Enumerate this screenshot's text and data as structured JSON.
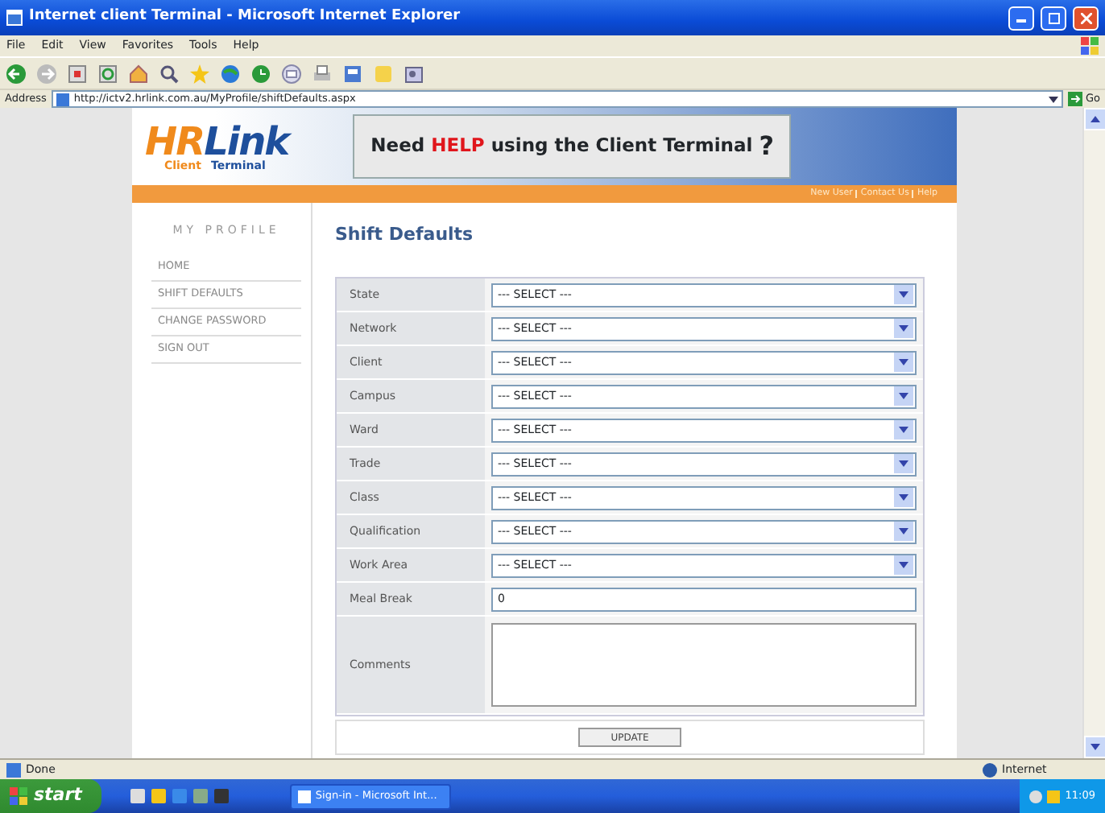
{
  "window": {
    "title": "Internet client Terminal - Microsoft Internet Explorer"
  },
  "menu": [
    "File",
    "Edit",
    "View",
    "Favorites",
    "Tools",
    "Help"
  ],
  "address": {
    "label": "Address",
    "url": "http://ictv2.hrlink.com.au/MyProfile/shiftDefaults.aspx",
    "go": "Go"
  },
  "logo": {
    "primary": "HR",
    "secondary": "Link",
    "sub_left": "Client",
    "sub_right": "Terminal"
  },
  "help_banner": {
    "before": "Need",
    "highlight": "HELP",
    "after": "using the Client Terminal",
    "mark": "?"
  },
  "top_links": [
    "New User",
    "Contact Us",
    "Help"
  ],
  "sidebar": {
    "heading": "MY PROFILE",
    "items": [
      "HOME",
      "SHIFT DEFAULTS",
      "CHANGE PASSWORD",
      "SIGN OUT"
    ]
  },
  "page_title": "Shift Defaults",
  "fields": [
    {
      "label": "State",
      "kind": "select",
      "value": "--- SELECT ---"
    },
    {
      "label": "Network",
      "kind": "select",
      "value": "--- SELECT ---"
    },
    {
      "label": "Client",
      "kind": "select",
      "value": "--- SELECT ---"
    },
    {
      "label": "Campus",
      "kind": "select",
      "value": "--- SELECT ---"
    },
    {
      "label": "Ward",
      "kind": "select",
      "value": "--- SELECT ---"
    },
    {
      "label": "Trade",
      "kind": "select",
      "value": "--- SELECT ---"
    },
    {
      "label": "Class",
      "kind": "select",
      "value": "--- SELECT ---"
    },
    {
      "label": "Qualification",
      "kind": "select",
      "value": "--- SELECT ---"
    },
    {
      "label": "Work Area",
      "kind": "select",
      "value": "--- SELECT ---"
    },
    {
      "label": "Meal Break",
      "kind": "input",
      "value": "0"
    },
    {
      "label": "Comments",
      "kind": "textarea"
    }
  ],
  "update_button": "UPDATE",
  "status_bar": {
    "text": "Done",
    "zone": "Internet"
  },
  "taskbar": {
    "start": "start",
    "task": "Sign-in - Microsoft Int...",
    "clock": "11:09"
  }
}
